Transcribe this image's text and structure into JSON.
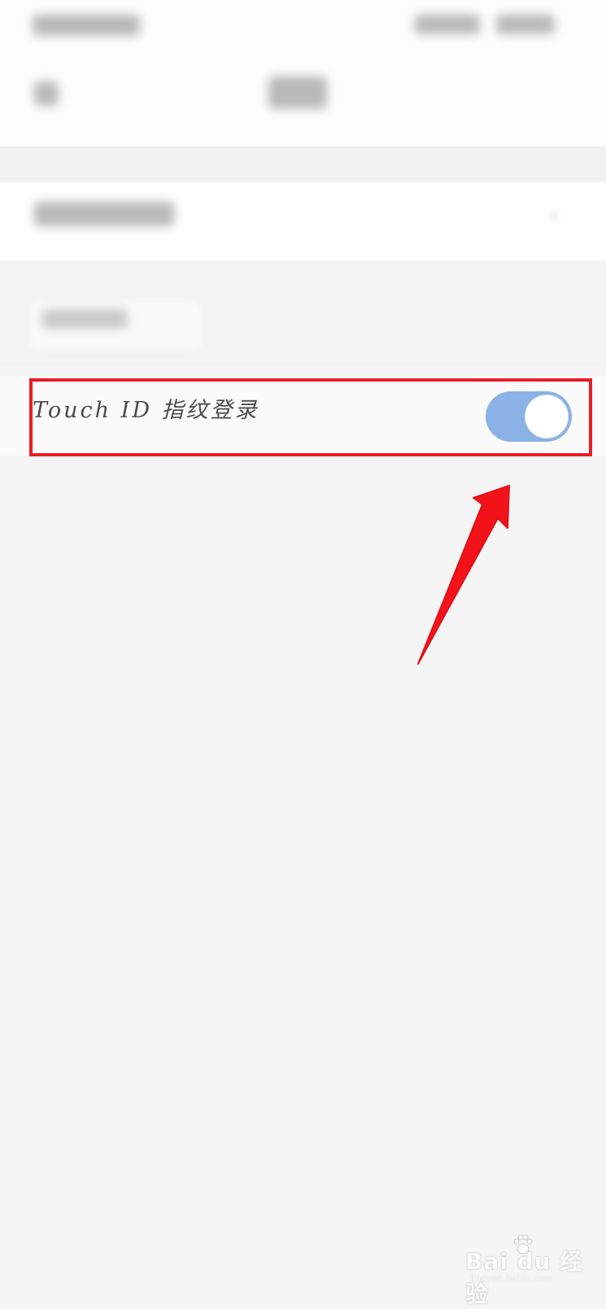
{
  "touch_id_row": {
    "label": "Touch ID 指纹登录",
    "toggle_on": true
  },
  "watermark": {
    "brand": "Bai du 经验",
    "url": "jingyan.baidu.com"
  },
  "colors": {
    "toggle_on": "#8ab2e6",
    "highlight": "#ec1c24",
    "arrow": "#f2131a",
    "background": "#f5f5f6"
  },
  "icons": {
    "back": "back-arrow-icon",
    "row_chevron": "chevron-right-icon",
    "annotation": "red-arrow-annotation-icon"
  }
}
